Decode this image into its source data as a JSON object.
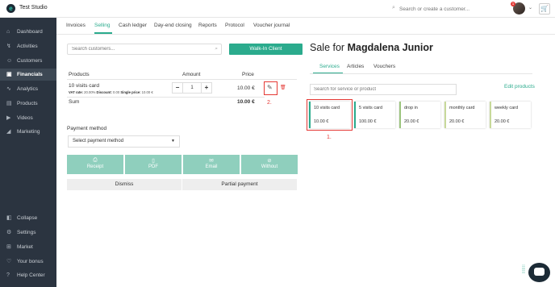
{
  "header": {
    "studio_name": "Test Studio",
    "search_placeholder": "Search or create a customer...",
    "notification_count": "1"
  },
  "sidebar": {
    "items": [
      {
        "label": "Dashboard",
        "icon": "home-icon",
        "glyph": "⌂"
      },
      {
        "label": "Activities",
        "icon": "activities-icon",
        "glyph": "↯"
      },
      {
        "label": "Customers",
        "icon": "customers-icon",
        "glyph": "☺"
      },
      {
        "label": "Financials",
        "icon": "financials-icon",
        "glyph": "▣",
        "active": true
      },
      {
        "label": "Analytics",
        "icon": "analytics-icon",
        "glyph": "∿"
      },
      {
        "label": "Products",
        "icon": "products-icon",
        "glyph": "▤"
      },
      {
        "label": "Videos",
        "icon": "videos-icon",
        "glyph": "▶"
      },
      {
        "label": "Marketing",
        "icon": "marketing-icon",
        "glyph": "◢"
      },
      {
        "label": "Collapse",
        "icon": "collapse-icon",
        "glyph": "◧"
      },
      {
        "label": "Settings",
        "icon": "settings-icon",
        "glyph": "⚙"
      },
      {
        "label": "Market",
        "icon": "market-icon",
        "glyph": "⊞"
      },
      {
        "label": "Your bonus",
        "icon": "heart-icon",
        "glyph": "♡"
      },
      {
        "label": "Help Center",
        "icon": "help-icon",
        "glyph": "?"
      }
    ]
  },
  "tabs": [
    "Invoices",
    "Selling",
    "Cash ledger",
    "Day-end closing",
    "Reports",
    "Protocol",
    "Voucher journal"
  ],
  "left": {
    "customer_search_placeholder": "Search customers...",
    "walkin_label": "Walk-In Client",
    "col_products": "Products",
    "col_amount": "Amount",
    "col_price": "Price",
    "product_name": "10 visits card",
    "vat_label": "VAT rate:",
    "vat_value": "20.00%",
    "discount_label": "Discount:",
    "discount_value": "0.00",
    "single_price_label": "Single price:",
    "single_price_value": "10.00 €",
    "quantity": "1",
    "line_price": "10.00 €",
    "sum_label": "Sum",
    "sum_value": "10.00 €",
    "annotation_2": "2.",
    "payment_method_label": "Payment method",
    "payment_select": "Select payment method",
    "pay_buttons": [
      {
        "label": "Receipt",
        "glyph": "⎙"
      },
      {
        "label": "PDF",
        "glyph": "▯"
      },
      {
        "label": "Email",
        "glyph": "✉"
      },
      {
        "label": "Without",
        "glyph": "⊘"
      }
    ],
    "dismiss_label": "Dismiss",
    "partial_label": "Partial payment"
  },
  "right": {
    "sale_for": "Sale for",
    "customer_name": "Magdalena Junior",
    "tabs": [
      "Services",
      "Articles",
      "Vouchers"
    ],
    "service_search_placeholder": "Search for service or product",
    "edit_products": "Edit products",
    "annotation_1": "1.",
    "cards": [
      {
        "name": "10 visits card",
        "price": "10.00 €",
        "color": "#2bab8d"
      },
      {
        "name": "5 visits card",
        "price": "100.00 €",
        "color": "#2bab8d"
      },
      {
        "name": "drop in",
        "price": "20.00 €",
        "color": "#9bc47d"
      },
      {
        "name": "monthly card",
        "price": "20.00 €",
        "color": "#c7d99a"
      },
      {
        "name": "weekly card",
        "price": "20.00 €",
        "color": "#c7d99a"
      }
    ]
  }
}
